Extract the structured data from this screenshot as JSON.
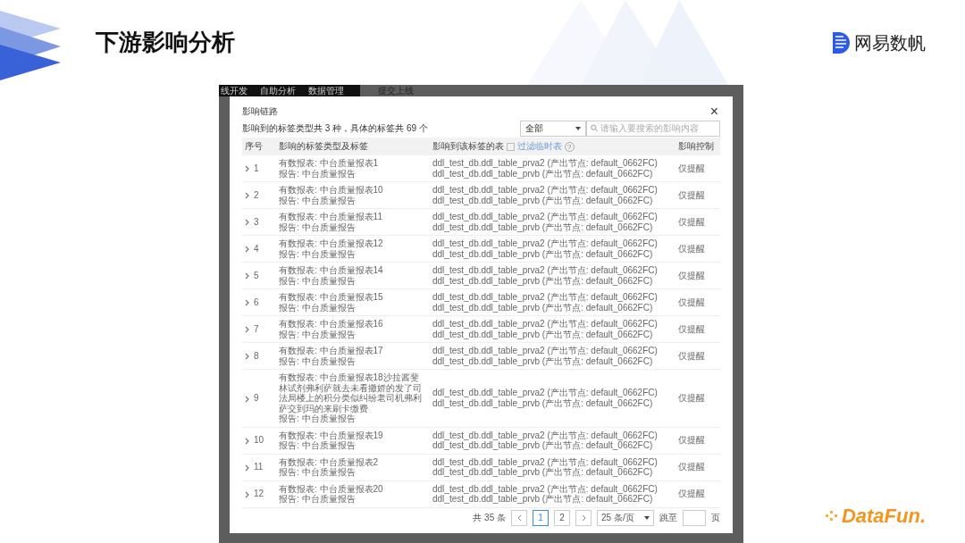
{
  "slide": {
    "title": "下游影响分析",
    "brand": "网易数帆",
    "footer_logo": "DataFun."
  },
  "background_app": {
    "nav_items": [
      "线开发",
      "自助分析",
      "数据管理"
    ],
    "page_title": "提交上线"
  },
  "dialog": {
    "title": "影响链路",
    "close": "×",
    "summary": "影响到的标签类型共 3 种，具体的标签共 69 个",
    "filter": {
      "value": "全部"
    },
    "search": {
      "placeholder": "请输入要搜索的影响内容"
    },
    "columns": [
      "序号",
      "影响的标签类型及标签",
      "影响到该标签的表",
      "影响控制"
    ],
    "filter_temp": {
      "label": "过滤临时表",
      "checked": false,
      "help": "?"
    },
    "rows": [
      {
        "index": "1",
        "expanded": false,
        "tags": [
          "有数报表: 中台质量报表1",
          "报告: 中台质量报告"
        ],
        "tables": [
          "ddl_test_db.ddl_table_prva2 (产出节点: default_0662FC)",
          "ddl_test_db.ddl_table_prvb (产出节点: default_0662FC)"
        ],
        "control": "仅提醒"
      },
      {
        "index": "2",
        "expanded": false,
        "tags": [
          "有数报表: 中台质量报表10",
          "报告: 中台质量报告"
        ],
        "tables": [
          "ddl_test_db.ddl_table_prva2 (产出节点: default_0662FC)",
          "ddl_test_db.ddl_table_prvb (产出节点: default_0662FC)"
        ],
        "control": "仅提醒"
      },
      {
        "index": "3",
        "expanded": false,
        "tags": [
          "有数报表: 中台质量报表11",
          "报告: 中台质量报告"
        ],
        "tables": [
          "ddl_test_db.ddl_table_prva2 (产出节点: default_0662FC)",
          "ddl_test_db.ddl_table_prvb (产出节点: default_0662FC)"
        ],
        "control": "仅提醒"
      },
      {
        "index": "4",
        "expanded": false,
        "tags": [
          "有数报表: 中台质量报表12",
          "报告: 中台质量报告"
        ],
        "tables": [
          "ddl_test_db.ddl_table_prva2 (产出节点: default_0662FC)",
          "ddl_test_db.ddl_table_prvb (产出节点: default_0662FC)"
        ],
        "control": "仅提醒"
      },
      {
        "index": "5",
        "expanded": false,
        "tags": [
          "有数报表: 中台质量报表14",
          "报告: 中台质量报告"
        ],
        "tables": [
          "ddl_test_db.ddl_table_prva2 (产出节点: default_0662FC)",
          "ddl_test_db.ddl_table_prvb (产出节点: default_0662FC)"
        ],
        "control": "仅提醒"
      },
      {
        "index": "6",
        "expanded": false,
        "tags": [
          "有数报表: 中台质量报表15",
          "报告: 中台质量报告"
        ],
        "tables": [
          "ddl_test_db.ddl_table_prva2 (产出节点: default_0662FC)",
          "ddl_test_db.ddl_table_prvb (产出节点: default_0662FC)"
        ],
        "control": "仅提醒"
      },
      {
        "index": "7",
        "expanded": false,
        "tags": [
          "有数报表: 中台质量报表16",
          "报告: 中台质量报告"
        ],
        "tables": [
          "ddl_test_db.ddl_table_prva2 (产出节点: default_0662FC)",
          "ddl_test_db.ddl_table_prvb (产出节点: default_0662FC)"
        ],
        "control": "仅提醒"
      },
      {
        "index": "8",
        "expanded": false,
        "tags": [
          "有数报表: 中台质量报表17",
          "报告: 中台质量报告"
        ],
        "tables": [
          "ddl_test_db.ddl_table_prva2 (产出节点: default_0662FC)",
          "ddl_test_db.ddl_table_prvb (产出节点: default_0662FC)"
        ],
        "control": "仅提醒"
      },
      {
        "index": "9",
        "expanded": false,
        "tags": [
          "有数报表: 中台质量报表18沙拉酱斐林试剂弗利萨就去未看撒娇的发了司法局楼上的积分类似纠纷老司机弗利萨交到玛的来刷卡缴费",
          "报告: 中台质量报告"
        ],
        "tables": [
          "ddl_test_db.ddl_table_prva2 (产出节点: default_0662FC)",
          "ddl_test_db.ddl_table_prvb (产出节点: default_0662FC)"
        ],
        "control": "仅提醒"
      },
      {
        "index": "10",
        "expanded": false,
        "tags": [
          "有数报表: 中台质量报表19",
          "报告: 中台质量报告"
        ],
        "tables": [
          "ddl_test_db.ddl_table_prva2 (产出节点: default_0662FC)",
          "ddl_test_db.ddl_table_prvb (产出节点: default_0662FC)"
        ],
        "control": "仅提醒"
      },
      {
        "index": "11",
        "expanded": false,
        "tags": [
          "有数报表: 中台质量报表2",
          "报告: 中台质量报告"
        ],
        "tables": [
          "ddl_test_db.ddl_table_prva2 (产出节点: default_0662FC)",
          "ddl_test_db.ddl_table_prvb (产出节点: default_0662FC)"
        ],
        "control": "仅提醒"
      },
      {
        "index": "12",
        "expanded": false,
        "tags": [
          "有数报表: 中台质量报表20",
          "报告: 中台质量报告"
        ],
        "tables": [
          "ddl_test_db.ddl_table_prva2 (产出节点: default_0662FC)",
          "ddl_test_db.ddl_table_prvb (产出节点: default_0662FC)"
        ],
        "control": "仅提醒"
      }
    ],
    "pagination": {
      "total": "共 35 条",
      "pages": [
        {
          "label": "1",
          "selected": true
        },
        {
          "label": "2",
          "selected": false
        }
      ],
      "page_size": "25 条/页",
      "jump_label": "跳至",
      "page_suffix": "页"
    }
  }
}
